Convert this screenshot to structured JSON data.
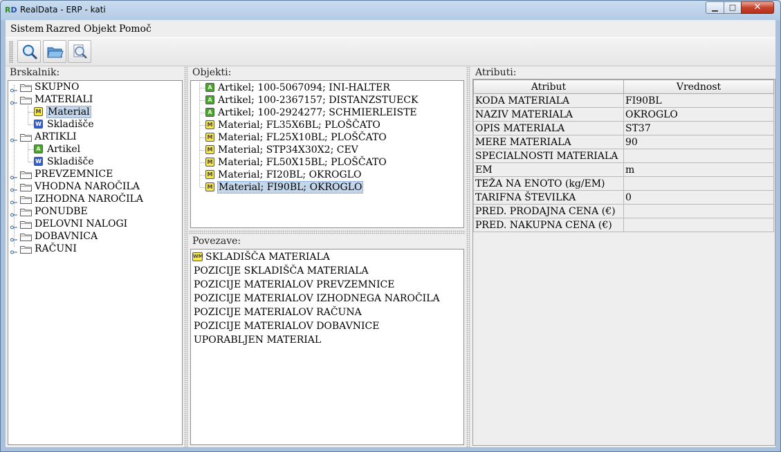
{
  "window": {
    "title": "RealData - ERP - kati",
    "logo": "RD"
  },
  "menu": [
    "Sistem",
    "Razred",
    "Objekt",
    "Pomoč"
  ],
  "toolbar": {
    "icons": [
      "search-icon",
      "folder-open-icon",
      "search-document-icon"
    ]
  },
  "browser": {
    "title": "Brskalnik:",
    "items": [
      {
        "label": "SKUPNO"
      },
      {
        "label": "MATERIALI"
      },
      {
        "label": "Material",
        "badge": "M",
        "selected": true
      },
      {
        "label": "Skladišče",
        "badge": "W"
      },
      {
        "label": "ARTIKLI"
      },
      {
        "label": "Artikel",
        "badge": "A"
      },
      {
        "label": "Skladišče",
        "badge": "W"
      },
      {
        "label": "PREVZEMNICE"
      },
      {
        "label": "VHODNA NAROČILA"
      },
      {
        "label": "IZHODNA NAROČILA"
      },
      {
        "label": "PONUDBE"
      },
      {
        "label": "DELOVNI NALOGI"
      },
      {
        "label": "DOBAVNICA"
      },
      {
        "label": "RAČUNI"
      }
    ]
  },
  "objects": {
    "title": "Objekti:",
    "items": [
      {
        "label": "Artikel; 100-5067094; INI-HALTER",
        "badge": "A"
      },
      {
        "label": "Artikel; 100-2367157; DISTANZSTUECK",
        "badge": "A"
      },
      {
        "label": "Artikel; 100-2924277; SCHMIERLEISTE",
        "badge": "A"
      },
      {
        "label": "Material; FL35X6BL; PLOŠČATO",
        "badge": "M"
      },
      {
        "label": "Material; FL25X10BL; PLOŠČATO",
        "badge": "M"
      },
      {
        "label": "Material; STP34X30X2; CEV",
        "badge": "M"
      },
      {
        "label": "Material; FL50X15BL; PLOŠČATO",
        "badge": "M"
      },
      {
        "label": "Material; FI20BL; OKROGLO",
        "badge": "M"
      },
      {
        "label": "Material; FI90BL; OKROGLO",
        "badge": "M",
        "selected": true
      }
    ]
  },
  "relations": {
    "title": "Povezave:",
    "items": [
      {
        "label": "SKLADIŠČA MATERIALA",
        "badge": "WM"
      },
      {
        "label": "POZICIJE SKLADIŠČA MATERIALA"
      },
      {
        "label": "POZICIJE MATERIALOV PREVZEMNICE"
      },
      {
        "label": "POZICIJE MATERIALOV IZHODNEGA NAROČILA"
      },
      {
        "label": "POZICIJE MATERIALOV RAČUNA"
      },
      {
        "label": "POZICIJE MATERIALOV DOBAVNICE"
      },
      {
        "label": "UPORABLJEN MATERIAL"
      }
    ]
  },
  "attributes": {
    "title": "Atributi:",
    "columns": [
      "Atribut",
      "Vrednost"
    ],
    "rows": [
      [
        "KODA MATERIALA",
        "FI90BL"
      ],
      [
        "NAZIV MATERIALA",
        "OKROGLO"
      ],
      [
        "OPIS MATERIALA",
        "ST37"
      ],
      [
        "MERE MATERIALA",
        "90"
      ],
      [
        "SPECIALNOSTI MATERIALA",
        ""
      ],
      [
        "EM",
        "m"
      ],
      [
        "TEŽA NA ENOTO (kg/EM)",
        ""
      ],
      [
        "TARIFNA ŠTEVILKA",
        "0"
      ],
      [
        "PRED. PRODAJNA CENA (€)",
        ""
      ],
      [
        "PRED. NAKUPNA CENA (€)",
        ""
      ]
    ]
  },
  "colors": {
    "selection": "#c3d6ea",
    "badge_material": "#f8e84a",
    "badge_article": "#4aa52e",
    "badge_warehouse": "#2f5fd0",
    "close_button": "#c9432c"
  }
}
